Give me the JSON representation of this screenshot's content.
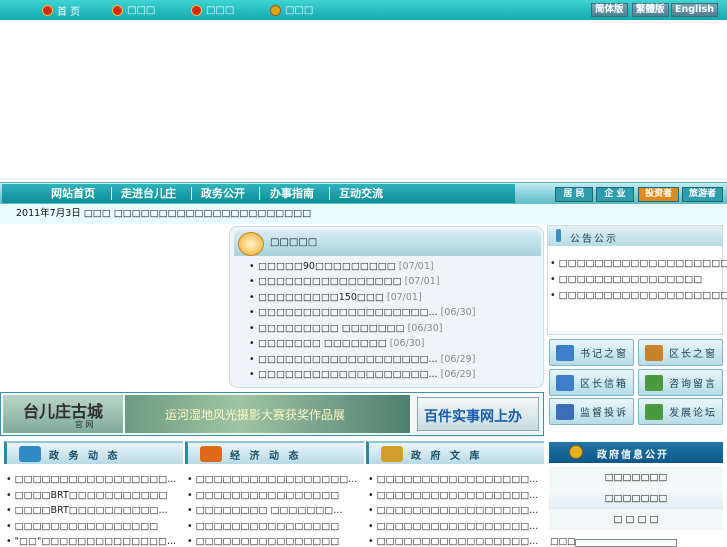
{
  "topbar": {
    "links": [
      {
        "label": "首 页"
      },
      {
        "label": "□□□"
      },
      {
        "label": "□□□"
      },
      {
        "label": "□□□"
      }
    ],
    "lang": [
      "简体版",
      "繁體版",
      "English"
    ]
  },
  "nav": {
    "items": [
      "网站首页",
      "走进台儿庄",
      "政务公开",
      "办事指南",
      "互动交流"
    ],
    "roles": [
      "居 民",
      "企 业",
      "投资者",
      "旅游者"
    ]
  },
  "ticker": "2011年7月3日 □□□ □□□□□□□□□□□□□□□□□□□□□□",
  "news": {
    "title": "□□□□□",
    "items": [
      {
        "text": "□□□□□90□□□□□□□□□",
        "date": "[07/01]"
      },
      {
        "text": "□□□□□□□□□□□□□□□□",
        "date": "[07/01]"
      },
      {
        "text": "□□□□□□□□□150□□□",
        "date": "[07/01]"
      },
      {
        "text": "□□□□□□□□□□□□□□□□□□□...",
        "date": "[06/30]"
      },
      {
        "text": "□□□□□□□□□ □□□□□□□",
        "date": "[06/30]"
      },
      {
        "text": "□□□□□□□ □□□□□□□",
        "date": "[06/30]"
      },
      {
        "text": "□□□□□□□□□□□□□□□□□□□...",
        "date": "[06/29]"
      },
      {
        "text": "□□□□□□□□□□□□□□□□□□□...",
        "date": "[06/29]"
      }
    ]
  },
  "notice": {
    "title": "公告公示",
    "items": [
      "□□□□□□□□□□□□□□□□□□□28□□",
      "□□□□□□□□□□□□□□□□",
      "□□□□□□□□□□□□□□□□□□□"
    ]
  },
  "buttons": [
    {
      "label": "书记之窗",
      "color": "#3a7fc8"
    },
    {
      "label": "区长之窗",
      "color": "#c8832a"
    },
    {
      "label": "区长信箱",
      "color": "#3a7fc8"
    },
    {
      "label": "咨询留言",
      "color": "#4a9a3f"
    },
    {
      "label": "监督投诉",
      "color": "#3a6fb8"
    },
    {
      "label": "发展论坛",
      "color": "#4a9a3f"
    }
  ],
  "ads": {
    "a1_title": "台儿庄古城",
    "a1_sub": "官 网",
    "a2": "运河湿地风光摄影大赛获奖作品展",
    "a3": "百件实事网上办"
  },
  "sections": [
    {
      "title": "政 务 动 态",
      "icon_color": "#2f89c5",
      "items": [
        "□□□□□□□□□□□□□□□□□...",
        "□□□□BRT□□□□□□□□□□□",
        "□□□□BRT□□□□□□□□□□...",
        "□□□□□□□□□□□□□□□□",
        "\"□□\"□□□□□□□□□□□□□□..."
      ]
    },
    {
      "title": "经 济 动 态",
      "icon_color": "#e06a1c",
      "items": [
        "□□□□□□□□□□□□□□□□□...",
        "□□□□□□□□□□□□□□□□",
        "□□□□□□□□ □□□□□□□...",
        "□□□□□□□□□□□□□□□□",
        "□□□□□□□□□□□□□□□□"
      ]
    },
    {
      "title": "政 府 文 库",
      "icon_color": "#d2a02a",
      "items": [
        "□□□□□□□□□□□□□□□□□...",
        "□□□□□□□□□□□□□□□□□...",
        "□□□□□□□□□□□□□□□□□...",
        "□□□□□□□□□□□□□□□□□...",
        "□□□□□□□□□□□□□□□□□..."
      ]
    }
  ],
  "info": {
    "title": "政府信息公开",
    "rows": [
      "□□□□□□□",
      "□□□□□□□",
      "□ □ □ □"
    ],
    "search_label": "□□□"
  }
}
